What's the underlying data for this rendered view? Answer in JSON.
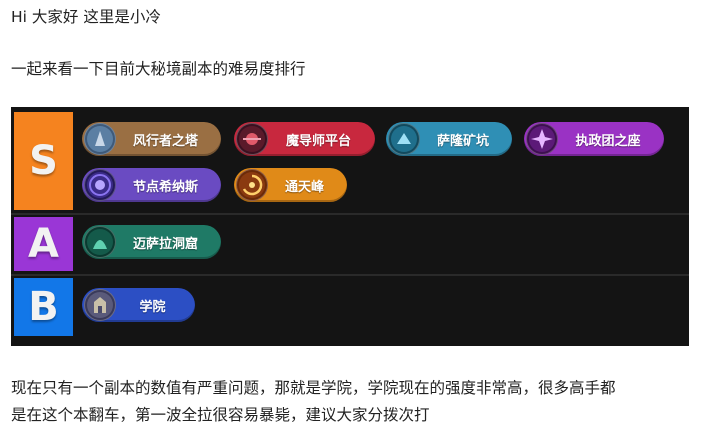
{
  "intro": {
    "greeting": "Hi 大家好 这里是小冷",
    "subtitle": "一起来看一下目前大秘境副本的难易度排行"
  },
  "tiers": [
    {
      "label": "S",
      "color": "#f5831f",
      "dungeons": [
        {
          "name": "风行者之塔",
          "color": "#9a6f43",
          "icon": "tower-icon"
        },
        {
          "name": "魔导师平台",
          "color": "#c8283e",
          "icon": "platform-icon"
        },
        {
          "name": "萨隆矿坑",
          "color": "#2f8fb5",
          "icon": "pit-icon"
        },
        {
          "name": "执政团之座",
          "color": "#9a32c4",
          "icon": "seat-icon"
        },
        {
          "name": "节点希纳斯",
          "color": "#6a4bc2",
          "icon": "nexus-icon"
        },
        {
          "name": "通天峰",
          "color": "#e08a18",
          "icon": "peak-icon"
        }
      ]
    },
    {
      "label": "A",
      "color": "#9a36d6",
      "dungeons": [
        {
          "name": "迈萨拉洞窟",
          "color": "#1f7a66",
          "icon": "cavern-icon"
        }
      ]
    },
    {
      "label": "B",
      "color": "#1277e8",
      "dungeons": [
        {
          "name": "学院",
          "color": "#2c4fc4",
          "icon": "academy-icon"
        }
      ]
    }
  ],
  "commentary": {
    "line1": "现在只有一个副本的数值有严重问题，那就是学院，学院现在的强度非常高，很多高手都",
    "line2": "是在这个本翻车，第一波全拉很容易暴毙，建议大家分拨次打"
  }
}
